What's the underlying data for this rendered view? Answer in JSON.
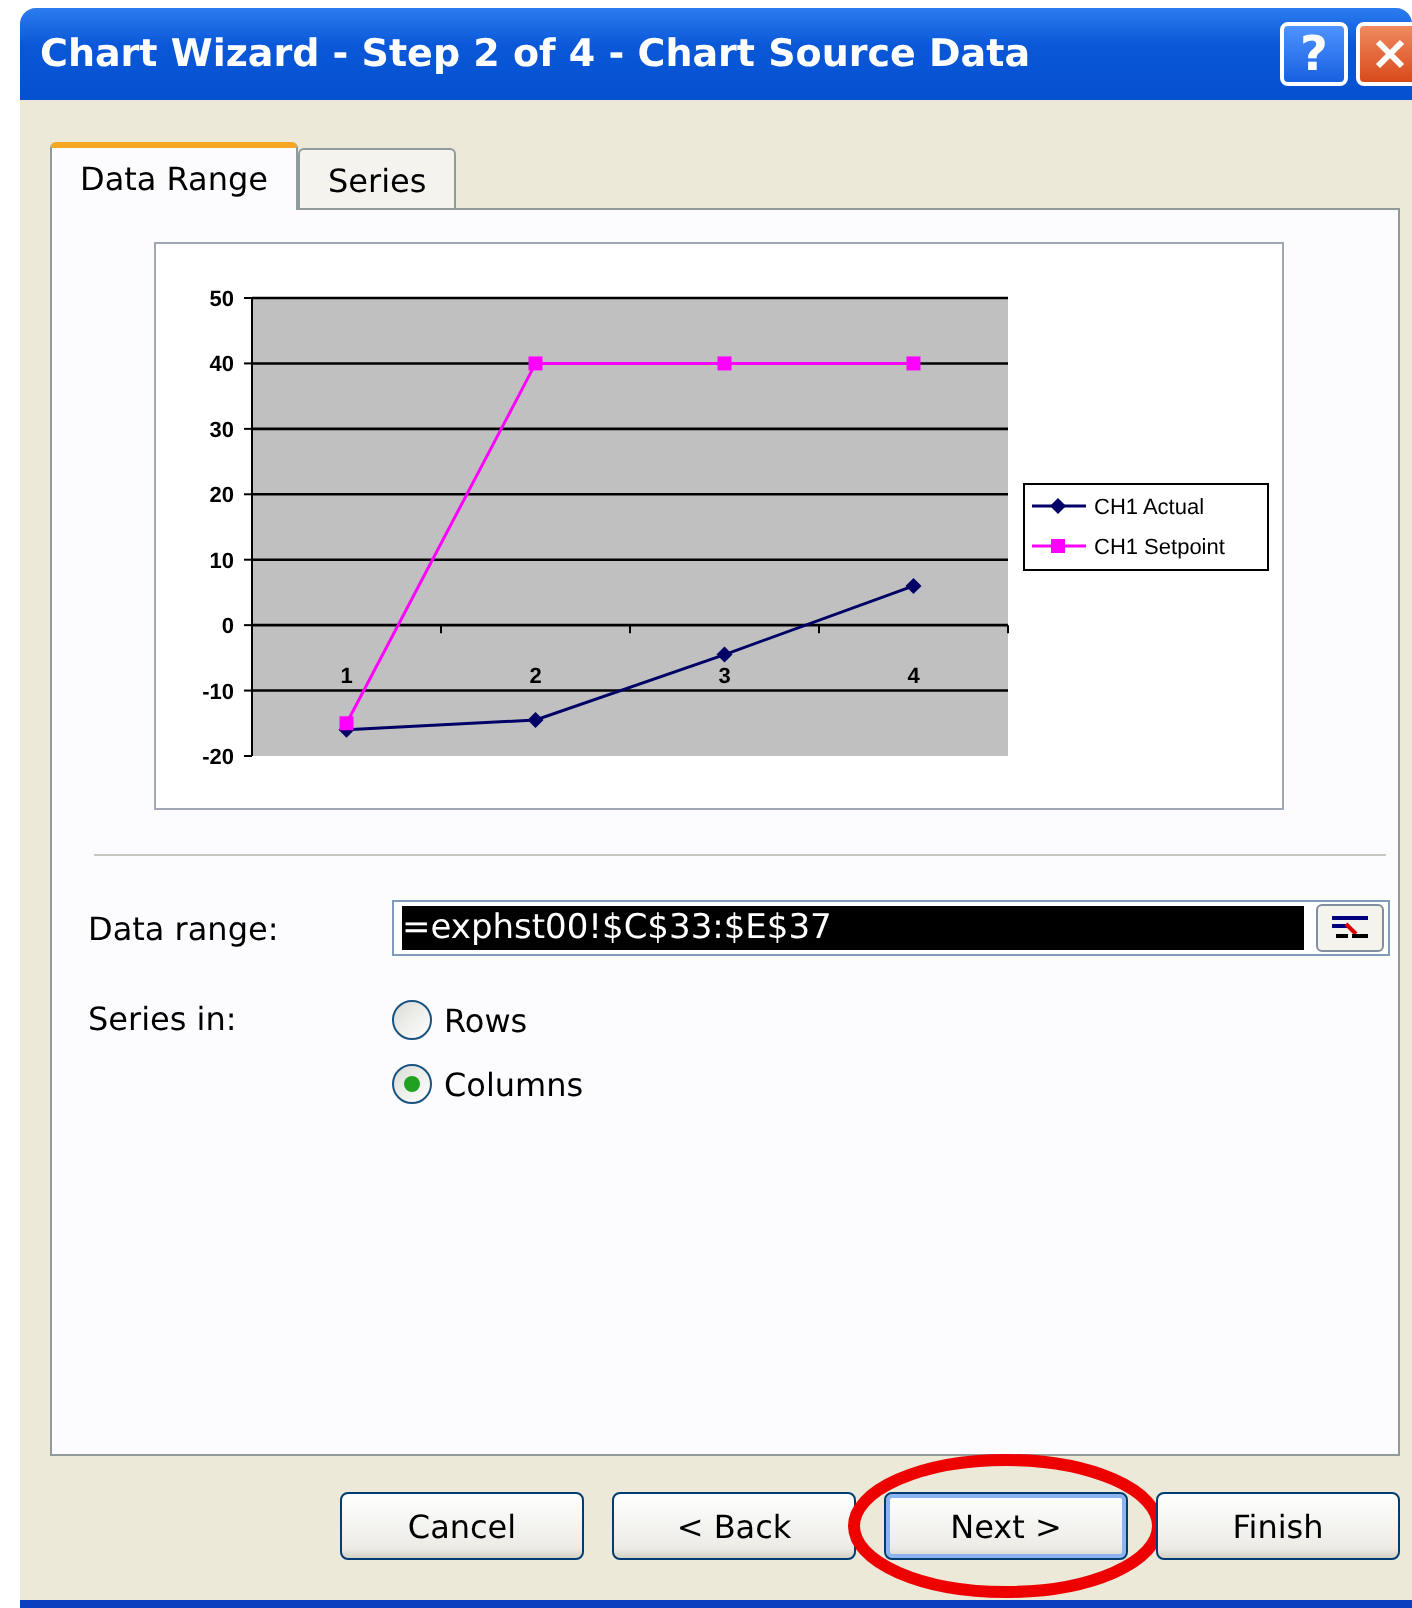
{
  "window": {
    "title": "Chart Wizard - Step 2 of 4 - Chart Source Data",
    "controls": [
      {
        "kind": "help",
        "label": "?"
      },
      {
        "kind": "close"
      }
    ]
  },
  "tabs": [
    {
      "label": "Data Range",
      "selected": true
    },
    {
      "label": "Series",
      "selected": false
    }
  ],
  "preview": {
    "chart_data": {
      "type": "line",
      "categories": [
        "1",
        "2",
        "3",
        "4"
      ],
      "series": [
        {
          "name": "CH1 Actual",
          "color": "#000066",
          "marker": "diamond",
          "values": [
            -16,
            -14.5,
            -4.5,
            6
          ]
        },
        {
          "name": "CH1 Setpoint",
          "color": "#ff00ff",
          "marker": "square",
          "values": [
            -15,
            40,
            40,
            40
          ]
        }
      ],
      "grid": "y",
      "legend": true,
      "ylim": [
        -20,
        50
      ],
      "yticks": [
        -20,
        -10,
        0,
        10,
        20,
        30,
        40,
        50
      ]
    }
  },
  "data_range": {
    "label": "Data range:",
    "value": "=exphst00!$C$33:$E$37"
  },
  "series_in": {
    "label": "Series in:",
    "options": [
      {
        "label": "Rows",
        "selected": false
      },
      {
        "label": "Columns",
        "selected": true
      }
    ]
  },
  "buttons": [
    {
      "label": "Cancel",
      "highlighted": false,
      "default": false
    },
    {
      "label": "< Back",
      "highlighted": false,
      "default": false
    },
    {
      "label": "Next >",
      "highlighted": true,
      "default": true
    },
    {
      "label": "Finish",
      "highlighted": false,
      "default": false
    }
  ]
}
